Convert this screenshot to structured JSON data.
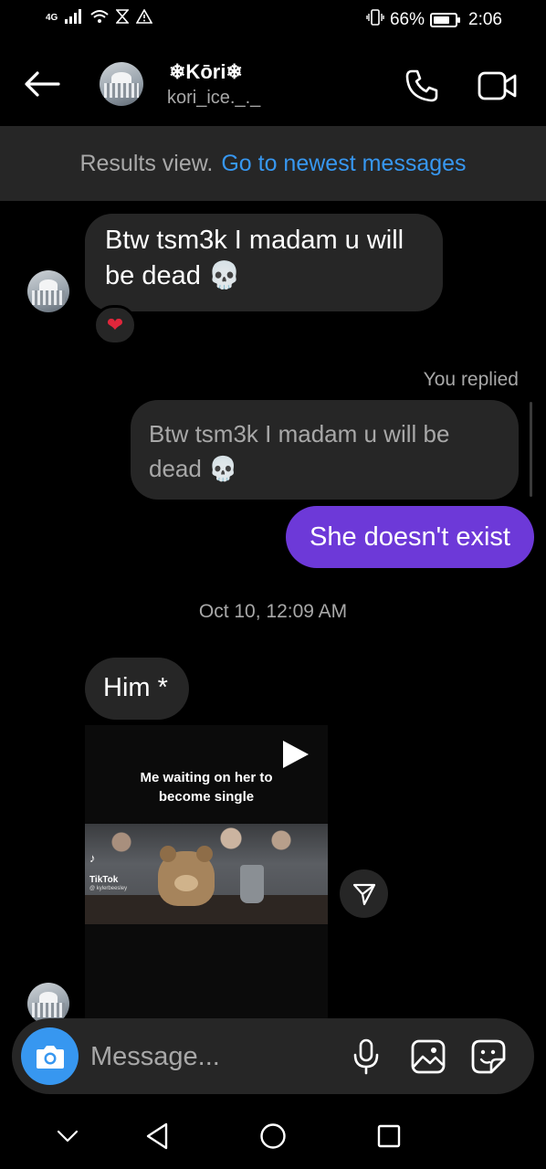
{
  "status_bar": {
    "network": "4G",
    "battery": "66%",
    "battery_level": 0.66,
    "time": "2:06"
  },
  "header": {
    "name": "❄Kōri❄",
    "username": "kori_ice._._",
    "icons": [
      "back-arrow-icon",
      "phone-icon",
      "video-camera-icon"
    ]
  },
  "results_bar": {
    "text": "Results view.",
    "link": "Go to newest messages"
  },
  "messages": [
    {
      "from": "them",
      "text": "Btw tsm3k I madam u will be dead 💀",
      "reaction": "❤"
    },
    {
      "from": "me",
      "replied_label": "You replied",
      "quote": "Btw tsm3k I madam u will be dead 💀",
      "text": "She doesn't exist"
    },
    {
      "timestamp": "Oct 10, 12:09 AM"
    },
    {
      "from": "them",
      "text": "Him *"
    },
    {
      "from": "them",
      "video": {
        "caption": "Me waiting on her to become single",
        "platform": "TikTok",
        "handle": "@ kylerbeesley"
      }
    }
  ],
  "composer": {
    "placeholder": "Message...",
    "icons": [
      "camera-icon",
      "microphone-icon",
      "gallery-icon",
      "sticker-icon"
    ]
  },
  "accent_colors": {
    "outgoing_bubble": "#6d39d8",
    "link": "#3797f0",
    "camera_button": "#3797f0",
    "reaction_heart": "#e0263b"
  }
}
